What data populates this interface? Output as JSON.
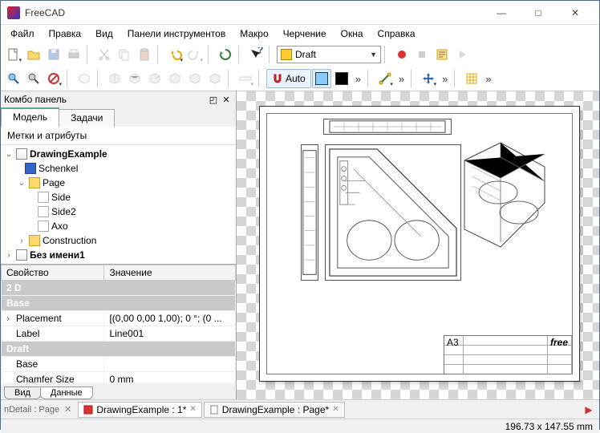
{
  "window": {
    "title": "FreeCAD"
  },
  "menu": [
    "Файл",
    "Правка",
    "Вид",
    "Панели инструментов",
    "Макро",
    "Черчение",
    "Окна",
    "Справка"
  ],
  "workbench": {
    "label": "Draft"
  },
  "toolbar2": {
    "auto": "Auto",
    "more": "»"
  },
  "combo": {
    "title": "Комбо панель",
    "tabs": [
      "Модель",
      "Задачи"
    ],
    "subtitle": "Метки и атрибуты"
  },
  "tree": {
    "root": "DrawingExample",
    "items": [
      "Schenkel",
      "Page",
      "Side",
      "Side2",
      "Axo",
      "Construction",
      "Без имени1"
    ]
  },
  "props": {
    "headers": [
      "Свойство",
      "Значение"
    ],
    "groups": {
      "g1": "2 D",
      "g2": "Base",
      "g3": "Draft"
    },
    "rows": {
      "placement_k": "Placement",
      "placement_v": "[(0,00 0,00 1,00); 0 °; (0 ...",
      "label_k": "Label",
      "label_v": "Line001",
      "base_k": "Base",
      "base_v": "",
      "chamfer_k": "Chamfer Size",
      "chamfer_v": "0 mm"
    },
    "bottom_tabs": [
      "Вид",
      "Данные"
    ]
  },
  "doctabs": {
    "truncated": "nDetail : Page",
    "t1": "DrawingExample : 1*",
    "t2": "DrawingExample : Page*"
  },
  "titleblock": {
    "size": "A3",
    "brand": "free"
  },
  "status": {
    "coords": "196.73 x 147.55 mm"
  }
}
